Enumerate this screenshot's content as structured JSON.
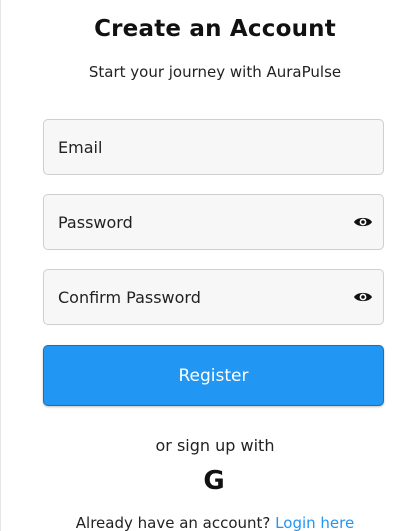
{
  "header": {
    "title": "Create an Account",
    "subtitle": "Start your journey with AuraPulse"
  },
  "form": {
    "email": {
      "placeholder": "Email",
      "value": ""
    },
    "password": {
      "placeholder": "Password",
      "value": "",
      "toggle_icon": "eye-icon"
    },
    "confirm_password": {
      "placeholder": "Confirm Password",
      "value": "",
      "toggle_icon": "eye-icon"
    },
    "register_label": "Register"
  },
  "social": {
    "label": "or sign up with",
    "google_glyph": "G",
    "google_icon": "google-icon"
  },
  "footer": {
    "prompt": "Already have an account? ",
    "login_link": "Login here"
  },
  "colors": {
    "accent": "#2196f3",
    "field_bg": "#f7f7f7",
    "field_border": "#cfcfcf",
    "text": "#222222"
  }
}
